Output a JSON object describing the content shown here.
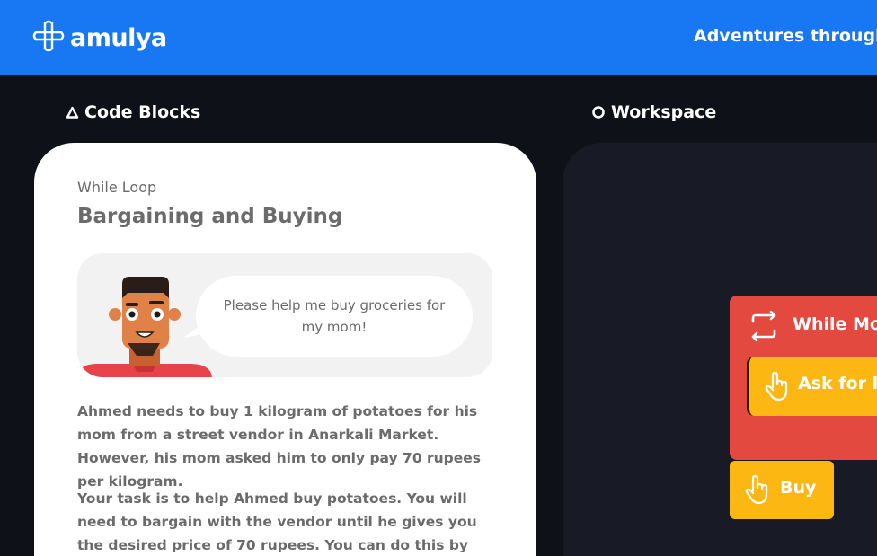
{
  "header": {
    "brand": "amulya",
    "tagline": "Adventures through"
  },
  "sections": {
    "code_blocks": "Code Blocks",
    "workspace": "Workspace"
  },
  "card": {
    "subtitle": "While Loop",
    "title": "Bargaining and Buying",
    "speech": "Please help me buy groceries for my mom!",
    "paragraph1": "Ahmed needs to buy 1 kilogram of potatoes for his mom from a street vendor in Anarkali Market. However, his mom asked him to only pay 70 rupees per kilogram.",
    "paragraph2": "Your task is to help Ahmed buy potatoes. You will need to bargain with the vendor until he gives you the desired price of 70 rupees. You can do this by using a loop, like"
  },
  "blocks": {
    "while": "While Mo",
    "ask": "Ask for lo",
    "buy": "Buy"
  },
  "colors": {
    "header_bg": "#1877f2",
    "page_bg": "#0f1119",
    "workspace_bg": "#181b25",
    "while_block": "#e4493f",
    "action_block": "#fdb713"
  },
  "icons": {
    "logo": "grid-loop-logo-icon",
    "code_blocks": "triangle-icon",
    "workspace": "circle-icon",
    "while": "loop-arrows-icon",
    "action": "pointing-hand-icon"
  }
}
